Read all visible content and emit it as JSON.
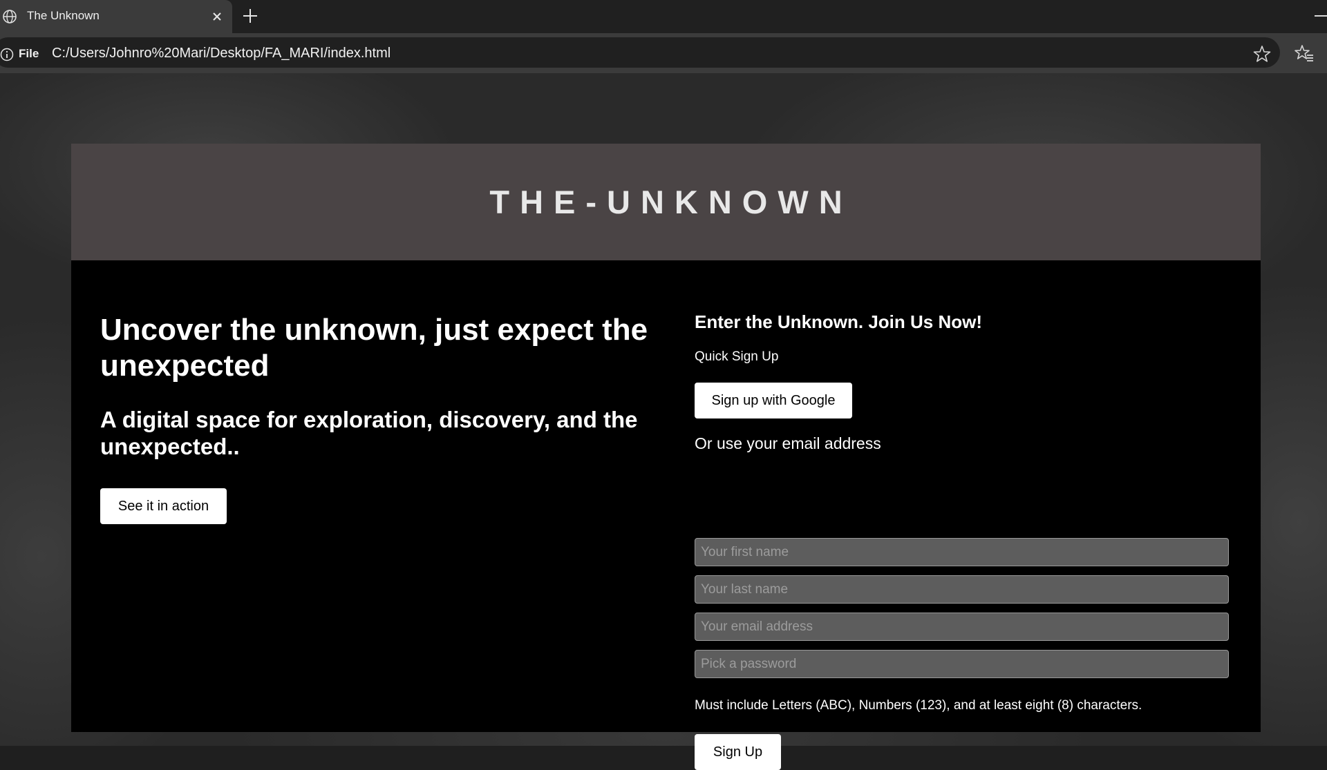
{
  "browser": {
    "tab_title": "The Unknown",
    "address_scheme": "File",
    "url": "C:/Users/Johnro%20Mari/Desktop/FA_MARI/index.html"
  },
  "page": {
    "site_title": "THE-UNKNOWN",
    "hero": {
      "heading": "Uncover the unknown, just expect the unexpected",
      "subheading": "A digital space for exploration, discovery, and the unexpected..",
      "cta_label": "See it in action"
    },
    "signup": {
      "heading": "Enter the Unknown. Join Us Now!",
      "quick_label": "Quick Sign Up",
      "google_label": "Sign up with Google",
      "or_label": "Or use your email address",
      "fields": [
        {
          "placeholder": "Your first name",
          "value": ""
        },
        {
          "placeholder": "Your last name",
          "value": ""
        },
        {
          "placeholder": "Your email address",
          "value": ""
        },
        {
          "placeholder": "Pick a password",
          "value": ""
        }
      ],
      "password_hint": "Must include Letters (ABC), Numbers (123), and at least eight (8) characters.",
      "submit_label": "Sign Up"
    }
  },
  "colors": {
    "header_band": "#4a4445",
    "card_background": "#000000",
    "input_background": "#5d5d5d",
    "button_background": "#ffffff"
  },
  "icons": [
    "globe-icon",
    "close-icon",
    "plus-icon",
    "info-icon",
    "star-icon",
    "favorites-icon"
  ]
}
